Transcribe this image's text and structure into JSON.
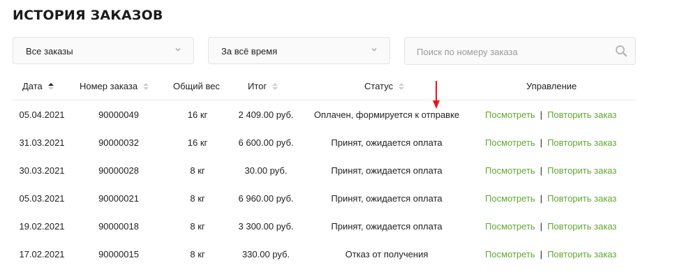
{
  "page": {
    "title": "ИСТОРИЯ ЗАКАЗОВ"
  },
  "filters": {
    "orders_value": "Все заказы",
    "period_value": "За всё время",
    "search_placeholder": "Поиск по номеру заказа"
  },
  "table": {
    "headers": {
      "date": "Дата",
      "order_number": "Номер заказа",
      "weight": "Общий вес",
      "total": "Итог",
      "status": "Статус",
      "actions": "Управление"
    },
    "link_view": "Посмотреть",
    "link_repeat": "Повторить заказ",
    "separator": "|",
    "rows": [
      {
        "date": "05.04.2021",
        "number": "90000049",
        "weight": "16 кг",
        "total": "2 409.00 руб.",
        "status": "Оплачен, формируется к отправке"
      },
      {
        "date": "31.03.2021",
        "number": "90000032",
        "weight": "16 кг",
        "total": "6 600.00 руб.",
        "status": "Принят, ожидается оплата"
      },
      {
        "date": "30.03.2021",
        "number": "90000028",
        "weight": "8 кг",
        "total": "30.00 руб.",
        "status": "Принят, ожидается оплата"
      },
      {
        "date": "05.03.2021",
        "number": "90000021",
        "weight": "8 кг",
        "total": "6 960.00 руб.",
        "status": "Принят, ожидается оплата"
      },
      {
        "date": "19.02.2021",
        "number": "90000018",
        "weight": "8 кг",
        "total": "3 300.00 руб.",
        "status": "Принят, ожидается оплата"
      },
      {
        "date": "17.02.2021",
        "number": "90000015",
        "weight": "8 кг",
        "total": "330.00 руб.",
        "status": "Отказ от получения"
      }
    ]
  },
  "colors": {
    "link": "#5fa830",
    "annotation_arrow": "#e8141b"
  },
  "icons": {
    "select": "chevron-down-icon",
    "search": "search-icon",
    "sort": "sort-icon",
    "annotation": "red-arrow-icon"
  }
}
